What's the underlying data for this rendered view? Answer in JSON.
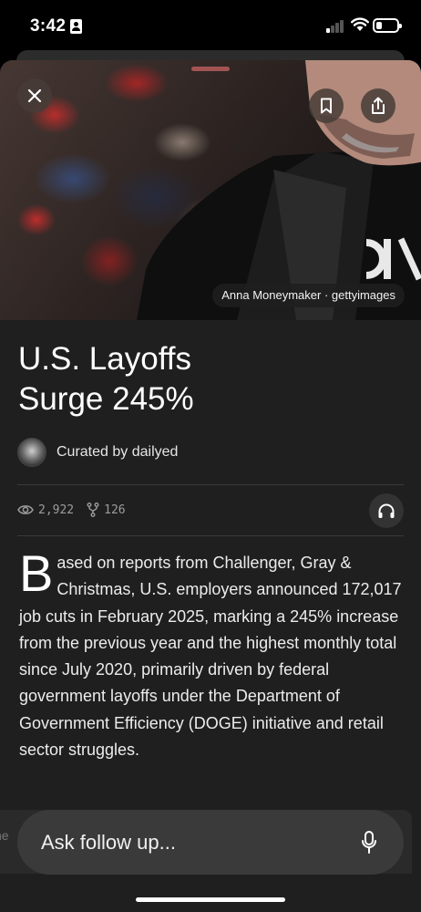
{
  "status_bar": {
    "time": "3:42",
    "signal_bars_active": 1,
    "battery_fraction": 0.3
  },
  "hero": {
    "photo_credit": "Anna Moneymaker · gettyimages",
    "close_icon": "close-icon",
    "bookmark_icon": "bookmark-icon",
    "share_icon": "share-icon"
  },
  "article": {
    "title_line1": "U.S. Layoffs",
    "title_line2": "Surge 245%",
    "curated_by": "Curated by dailyed",
    "views": "2,922",
    "forks": "126",
    "drop_cap": "B",
    "body": "ased on reports from Challenger, Gray & Christmas, U.S. employers announced 172,017 job cuts in February 2025, marking a 245% increase from the previous year and the highest monthly total since July 2020, primarily driven by federal government layoffs under the Department of Government Efficiency (DOGE) initiative and retail sector struggles."
  },
  "peek": {
    "text": "he"
  },
  "ask_bar": {
    "placeholder": "Ask follow up..."
  },
  "colors": {
    "background": "#1f1f1f",
    "ask_bar": "#3a3a3a",
    "text": "#ececec",
    "muted": "#9c9c9c"
  }
}
